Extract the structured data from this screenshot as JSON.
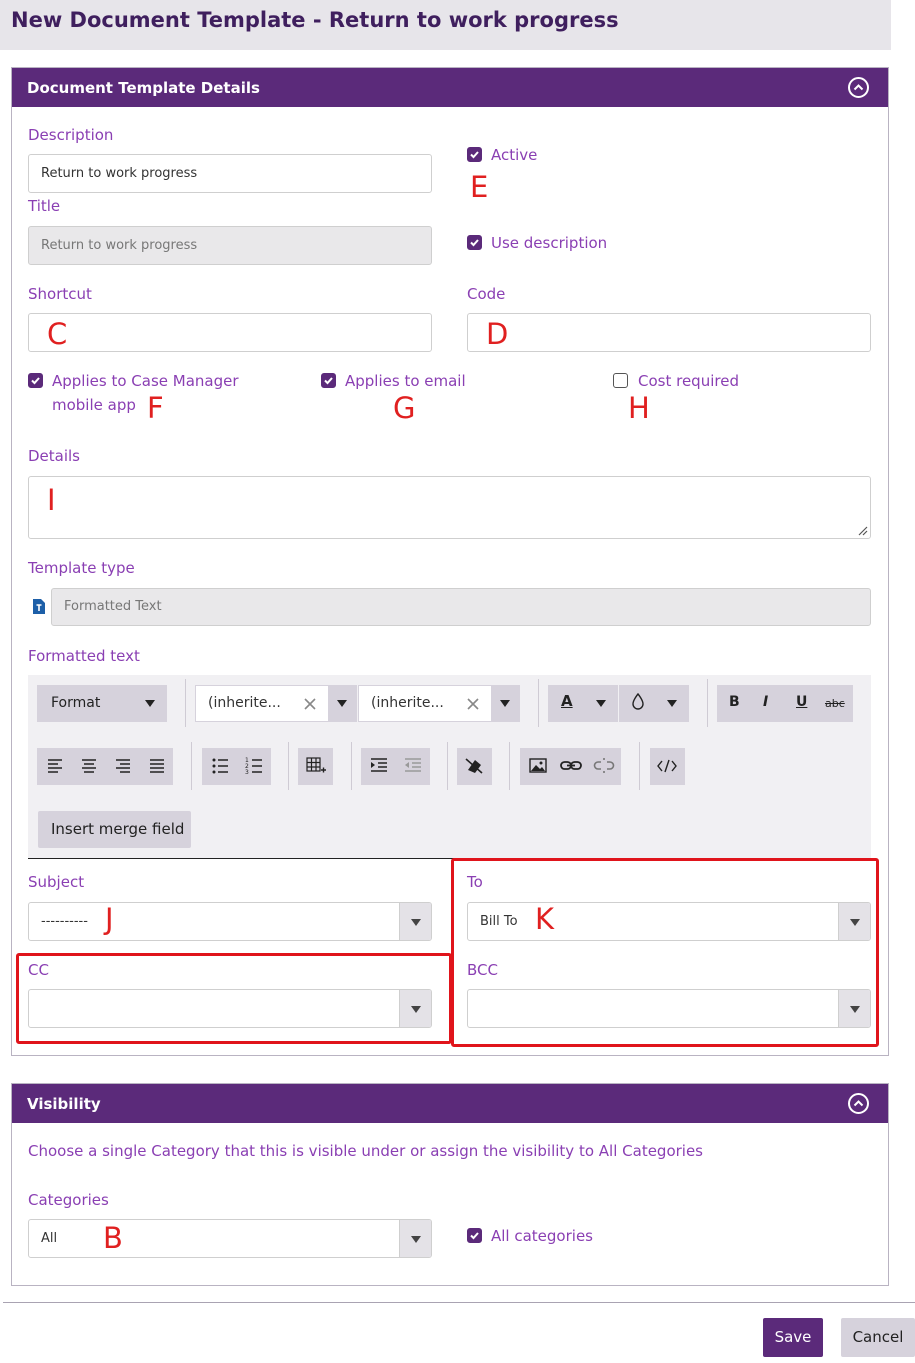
{
  "page": {
    "title": "New Document Template - Return to work progress"
  },
  "details_panel": {
    "title": "Document Template Details",
    "description": {
      "label": "Description",
      "value": "Return to work progress"
    },
    "title_field": {
      "label": "Title",
      "value": "Return to work progress"
    },
    "active": {
      "label": "Active",
      "checked": true
    },
    "use_description": {
      "label": "Use description",
      "checked": true
    },
    "shortcut": {
      "label": "Shortcut",
      "value": ""
    },
    "code": {
      "label": "Code",
      "value": ""
    },
    "applies_case_manager": {
      "label_line1": "Applies to Case Manager",
      "label_line2": "mobile app",
      "checked": true
    },
    "applies_email": {
      "label": "Applies to email",
      "checked": true
    },
    "cost_required": {
      "label": "Cost required",
      "checked": false
    },
    "details": {
      "label": "Details",
      "value": ""
    },
    "template_type": {
      "label": "Template type",
      "value": "Formatted Text",
      "icon": "document-text-icon"
    },
    "formatted_text": {
      "label": "Formatted text",
      "format_dropdown": "Format",
      "font_dropdown": "(inherite...",
      "size_dropdown": "(inherite...",
      "font_color_letter": "A",
      "bold": "B",
      "italic": "I",
      "underline": "U",
      "strikethrough": "abc",
      "insert_merge_field": "Insert merge field"
    },
    "subject": {
      "label": "Subject",
      "value": "----------"
    },
    "to": {
      "label": "To",
      "value": "Bill To"
    },
    "cc": {
      "label": "CC",
      "value": ""
    },
    "bcc": {
      "label": "BCC",
      "value": ""
    }
  },
  "visibility_panel": {
    "title": "Visibility",
    "help_text": "Choose a single Category that this is visible under or assign the visibility to All Categories",
    "categories": {
      "label": "Categories",
      "value": "All"
    },
    "all_categories": {
      "label": "All categories",
      "checked": true
    }
  },
  "footer": {
    "save_label": "Save",
    "cancel_label": "Cancel"
  },
  "annotations": {
    "A_shortcut": "C",
    "A_code": "D",
    "A_active": "E",
    "A_case_manager": "F",
    "A_email": "G",
    "A_cost": "H",
    "A_details": "I",
    "A_subject": "J",
    "A_to": "K",
    "A_categories": "B"
  },
  "colors": {
    "brand": "#5b2a7a",
    "label": "#8a3fb3",
    "annotation": "#e02020",
    "header_bg": "#e7e5ea"
  }
}
